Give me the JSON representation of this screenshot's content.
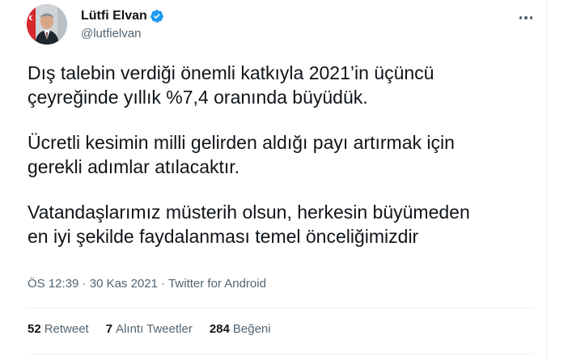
{
  "author": {
    "display_name": "Lütfi Elvan",
    "handle": "@lutfielvan",
    "verified_icon": "verified-badge-icon",
    "avatar_description": "avatar"
  },
  "tweet": {
    "paragraphs": [
      [
        "Dış talebin verdiği önemli katkıyla 2021’in üçüncü",
        "çeyreğinde yıllık %7,4 oranında büyüdük."
      ],
      [
        "Ücretli kesimin milli gelirden aldığı payı artırmak için",
        "gerekli adımlar atılacaktır."
      ],
      [
        "Vatandaşlarımız müsterih olsun, herkesin büyümeden",
        "en iyi şekilde faydalanması temel önceliğimizdir"
      ]
    ],
    "time": "ÖS 12:39",
    "separator": "·",
    "date": "30 Kas 2021",
    "source": "Twitter for Android"
  },
  "stats": {
    "retweets": {
      "count": "52",
      "label": "Retweet"
    },
    "quotes": {
      "count": "7",
      "label": "Alıntı Tweetler"
    },
    "likes": {
      "count": "284",
      "label": "Beğeni"
    }
  },
  "colors": {
    "text": "#0f1419",
    "secondary": "#536471",
    "verified": "#1d9bf0",
    "divider": "#eff3f4"
  }
}
